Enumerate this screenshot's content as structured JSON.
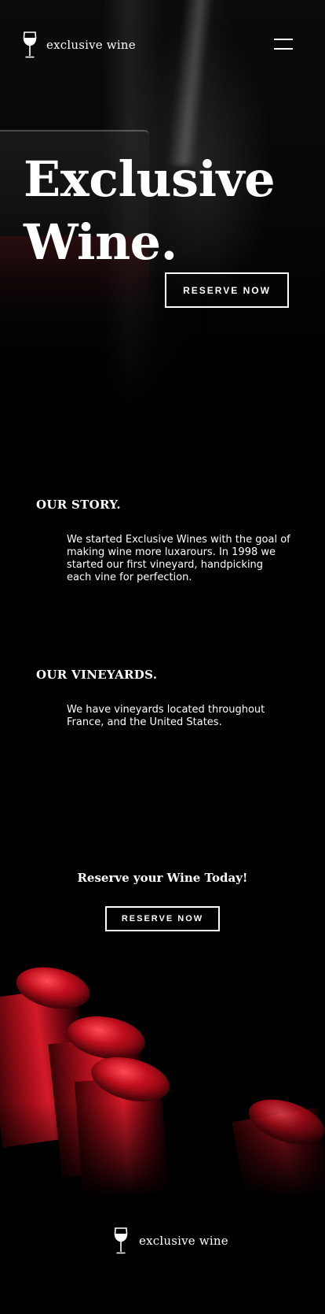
{
  "brand": {
    "name": "exclusive wine",
    "logo_icon": "wine-glass-icon"
  },
  "header": {
    "menu_icon": "hamburger-menu-icon"
  },
  "hero": {
    "title_line1": "Exclusive",
    "title_line2": "Wine.",
    "cta_label": "RESERVE NOW"
  },
  "story": {
    "heading": "OUR STORY.",
    "text": "We started Exclusive Wines with the goal of making wine more luxarours. In 1998 we started our first vineyard, handpicking each vine for perfection."
  },
  "vineyards": {
    "heading": "OUR VINEYARDS.",
    "text": "We have vineyards located throughout France, and the United States."
  },
  "reserve": {
    "heading": "Reserve your Wine Today!",
    "cta_label": "RESERVE NOW"
  },
  "footer": {
    "brand_name": "exclusive wine"
  },
  "colors": {
    "background": "#000000",
    "text": "#ffffff",
    "accent_red": "#c30f1e"
  }
}
